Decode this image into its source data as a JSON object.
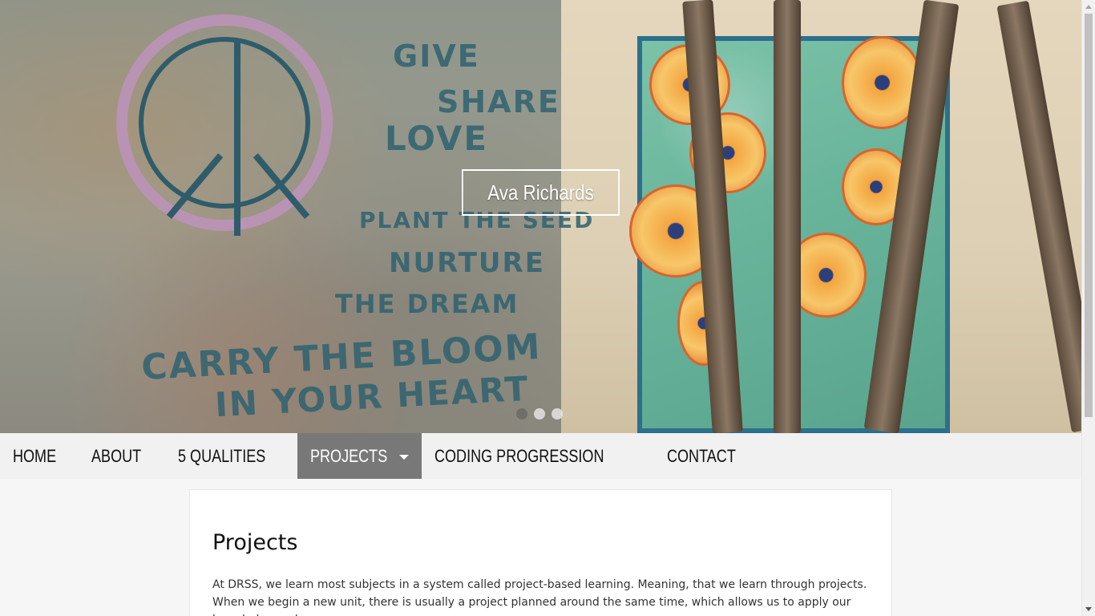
{
  "hero": {
    "title": "Ava Richards",
    "wall_text": [
      "GIVE",
      "SHARE",
      "LOVE",
      "PLANT THE SEED",
      "NURTURE",
      "THE DREAM",
      "CARRY THE BLOOM",
      "IN YOUR HEART"
    ],
    "carousel": {
      "slides": 3,
      "active_index": 0
    }
  },
  "nav": {
    "items": [
      {
        "label": "HOME"
      },
      {
        "label": "ABOUT"
      },
      {
        "label": "5 QUALITIES"
      },
      {
        "label": "PROJECTS",
        "active": true,
        "has_dropdown": true
      },
      {
        "label": "CODING PROGRESSION"
      },
      {
        "label": "CONTACT"
      }
    ]
  },
  "main": {
    "title": "Projects",
    "intro": "At DRSS, we learn most subjects in a system called project-based learning. Meaning, that we learn through projects. When we begin a new unit, there is usually a project planned around the same time, which allows us to apply our knowledge and use"
  },
  "colors": {
    "nav_bg": "#f1f1f1",
    "nav_active_bg": "#787878",
    "page_bg": "#f6f6f6",
    "card_bg": "#ffffff"
  },
  "icons": {
    "projects_dropdown": "caret-down-icon"
  }
}
